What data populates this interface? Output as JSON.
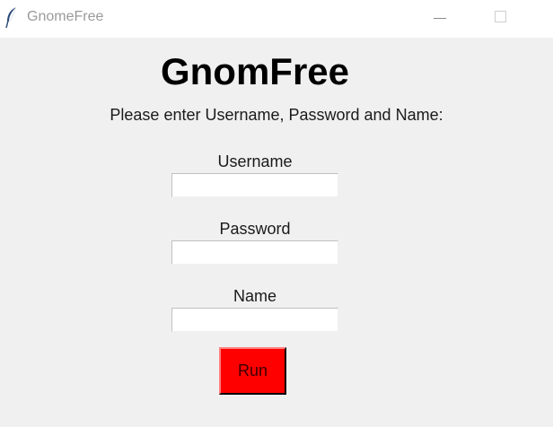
{
  "window": {
    "title": "GnomeFree",
    "icon": "feather-icon"
  },
  "main": {
    "heading": "GnomFree",
    "instructions": "Please enter Username, Password and Name:",
    "fields": [
      {
        "label": "Username",
        "value": ""
      },
      {
        "label": "Password",
        "value": ""
      },
      {
        "label": "Name",
        "value": ""
      }
    ],
    "run_label": "Run"
  },
  "colors": {
    "run_button": "#ff0000",
    "background": "#f0f0f0"
  }
}
